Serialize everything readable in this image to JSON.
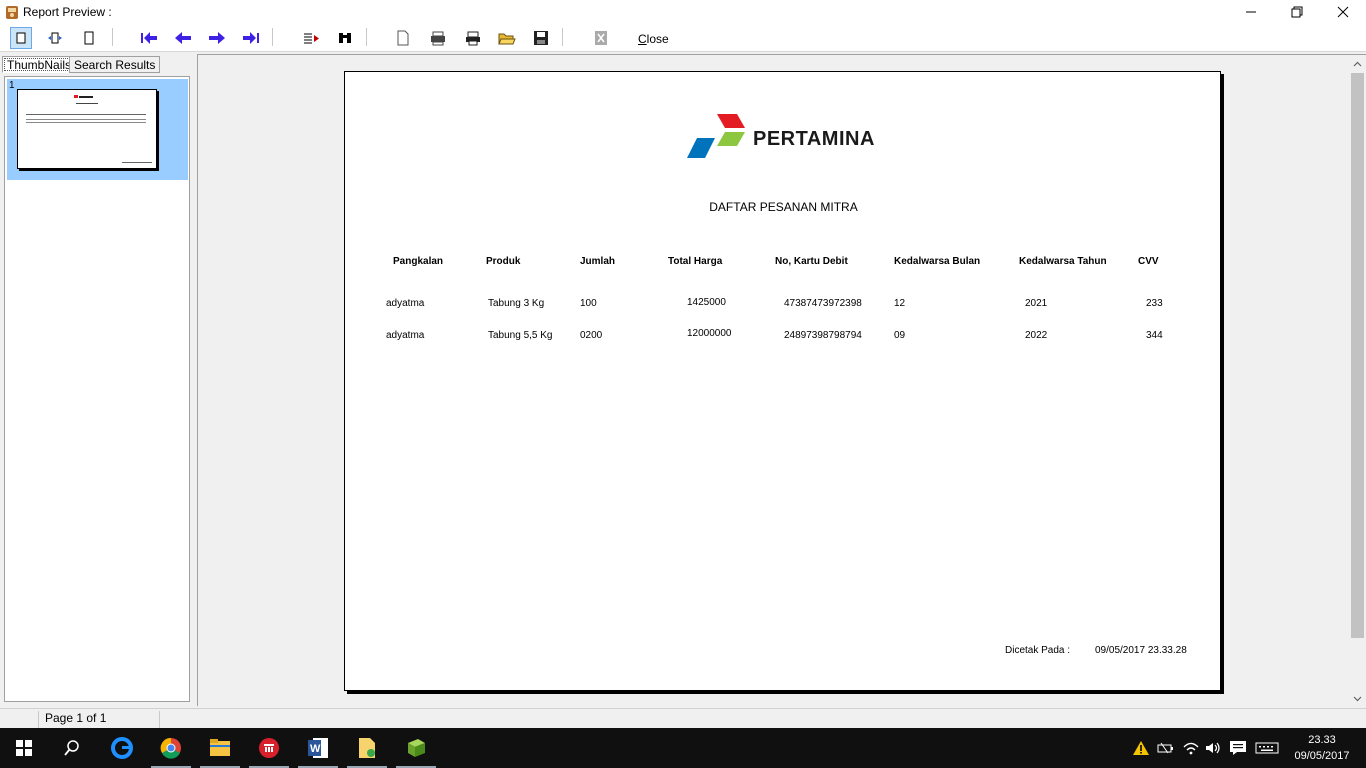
{
  "window": {
    "title": "Report Preview :"
  },
  "toolbar": {
    "close_label": "Close"
  },
  "left_panel": {
    "tabs": [
      "ThumbNails",
      "Search Results"
    ],
    "selected_tab": "ThumbNails",
    "thumbnail_number": "1"
  },
  "report": {
    "logo_text": "PERTAMINA",
    "title": "DAFTAR PESANAN MITRA",
    "columns": [
      "Pangkalan",
      "Produk",
      "Jumlah",
      "Total Harga",
      "No, Kartu Debit",
      "Kedalwarsa Bulan",
      "Kedalwarsa Tahun",
      "CVV"
    ],
    "rows": [
      [
        "adyatma",
        "Tabung 3 Kg",
        "100",
        "1425000",
        "47387473972398",
        "12",
        "2021",
        "233"
      ],
      [
        "adyatma",
        "Tabung 5,5 Kg",
        "0200",
        "12000000",
        "24897398798794",
        "09",
        "2022",
        "344"
      ]
    ],
    "footer_label": "Dicetak Pada :",
    "footer_value": "09/05/2017 23.33.28"
  },
  "status": {
    "page_info": "Page 1 of 1"
  },
  "taskbar": {
    "time": "23.33",
    "date": "09/05/2017"
  },
  "colors": {
    "logo_red": "#e31b23",
    "logo_green": "#8dc63f",
    "logo_blue": "#0073bc",
    "toolbar_arrow": "#3d22e6",
    "thumbnail_selected": "#99ccff",
    "taskbar_bg": "#101010"
  }
}
